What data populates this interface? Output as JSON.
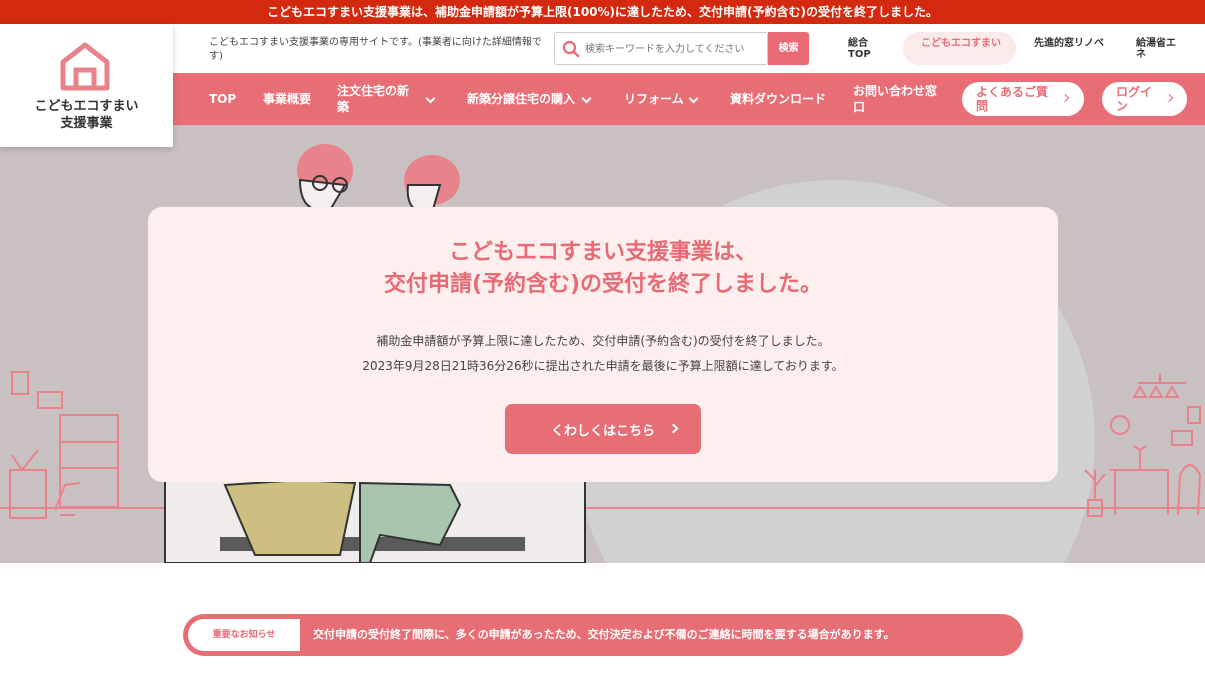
{
  "top_banner": "こどもエコすまい支援事業は、補助金申請額が予算上限(100%)に達したため、交付申請(予約含む)の受付を終了しました。",
  "logo": {
    "line1": "こどもエコすまい",
    "line2": "支援事業"
  },
  "header": {
    "description": "こどもエコすまい支援事業の専用サイトです。(事業者に向けた詳細情報です)",
    "search_placeholder": "検索キーワードを入力してください",
    "search_button": "検索",
    "util_links": [
      "総合TOP",
      "こどもエコすまい",
      "先進的窓リノベ",
      "給湯省エネ"
    ]
  },
  "nav": {
    "top": "TOP",
    "overview": "事業概要",
    "custom_house": "注文住宅の新築",
    "new_purchase": "新築分譲住宅の購入",
    "reform": "リフォーム",
    "downloads": "資料ダウンロード",
    "contact": "お問い合わせ窓口",
    "faq": "よくあるご質問",
    "login": "ログイン"
  },
  "notice": {
    "title_line1": "こどもエコすまい支援事業は、",
    "title_line2": "交付申請(予約含む)の受付を終了しました。",
    "body_line1": "補助金申請額が予算上限に達したため、交付申請(予約含む)の受付を終了しました。",
    "body_line2": "2023年9月28日21時36分26秒に提出された申請を最後に予算上限額に達しております。",
    "button": "くわしくはこちら"
  },
  "important": {
    "label": "重要なお知らせ",
    "text": "交付申請の受付終了間際に、多くの申請があったため、交付決定および不備のご連絡に時間を要する場合があります。"
  },
  "colors": {
    "brand_pink": "#e86e76",
    "banner_red": "#d32a0f",
    "hero_bg": "#c9c1c1",
    "card_bg": "#fcefed"
  }
}
